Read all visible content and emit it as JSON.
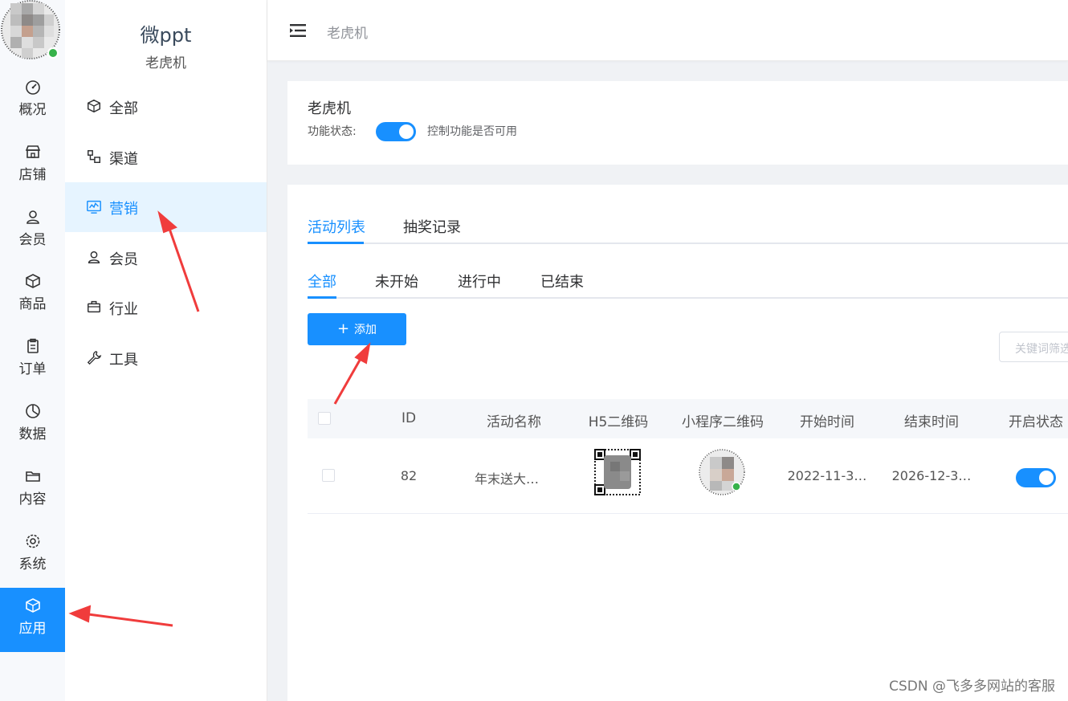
{
  "rail": {
    "items": [
      {
        "label": "概况",
        "icon": "dashboard-icon"
      },
      {
        "label": "店铺",
        "icon": "shop-icon"
      },
      {
        "label": "会员",
        "icon": "user-icon"
      },
      {
        "label": "商品",
        "icon": "box-icon"
      },
      {
        "label": "订单",
        "icon": "clipboard-icon"
      },
      {
        "label": "数据",
        "icon": "pie-chart-icon"
      },
      {
        "label": "内容",
        "icon": "folder-icon"
      },
      {
        "label": "系统",
        "icon": "gear-icon"
      },
      {
        "label": "应用",
        "icon": "cube-icon"
      }
    ],
    "active_index": 8
  },
  "brand": {
    "title": "微ppt",
    "subtitle": "老虎机"
  },
  "nav2": {
    "items": [
      {
        "label": "全部",
        "icon": "cube-icon"
      },
      {
        "label": "渠道",
        "icon": "channel-icon"
      },
      {
        "label": "营销",
        "icon": "marketing-chart-icon"
      },
      {
        "label": "会员",
        "icon": "user-icon"
      },
      {
        "label": "行业",
        "icon": "briefcase-icon"
      },
      {
        "label": "工具",
        "icon": "wrench-icon"
      }
    ],
    "active_index": 2
  },
  "header": {
    "breadcrumb": "老虎机"
  },
  "feature": {
    "title": "老虎机",
    "status_label": "功能状态:",
    "status_on": true,
    "status_desc": "控制功能是否可用"
  },
  "tabs": {
    "main": [
      "活动列表",
      "抽奖记录"
    ],
    "sub": [
      "全部",
      "未开始",
      "进行中",
      "已结束"
    ]
  },
  "toolbar": {
    "add_label": "添加",
    "search_placeholder": "关键词筛选"
  },
  "table": {
    "headers": [
      "ID",
      "活动名称",
      "H5二维码",
      "小程序二维码",
      "开始时间",
      "结束时间",
      "开启状态"
    ],
    "rows": [
      {
        "id": "82",
        "name": "年末送大…",
        "start": "2022-11-3…",
        "end": "2026-12-3…",
        "enabled": true
      }
    ]
  },
  "watermark": "CSDN @飞多多网站的客服",
  "colors": {
    "accent": "#1890ff",
    "arrow": "#f03c3c"
  }
}
